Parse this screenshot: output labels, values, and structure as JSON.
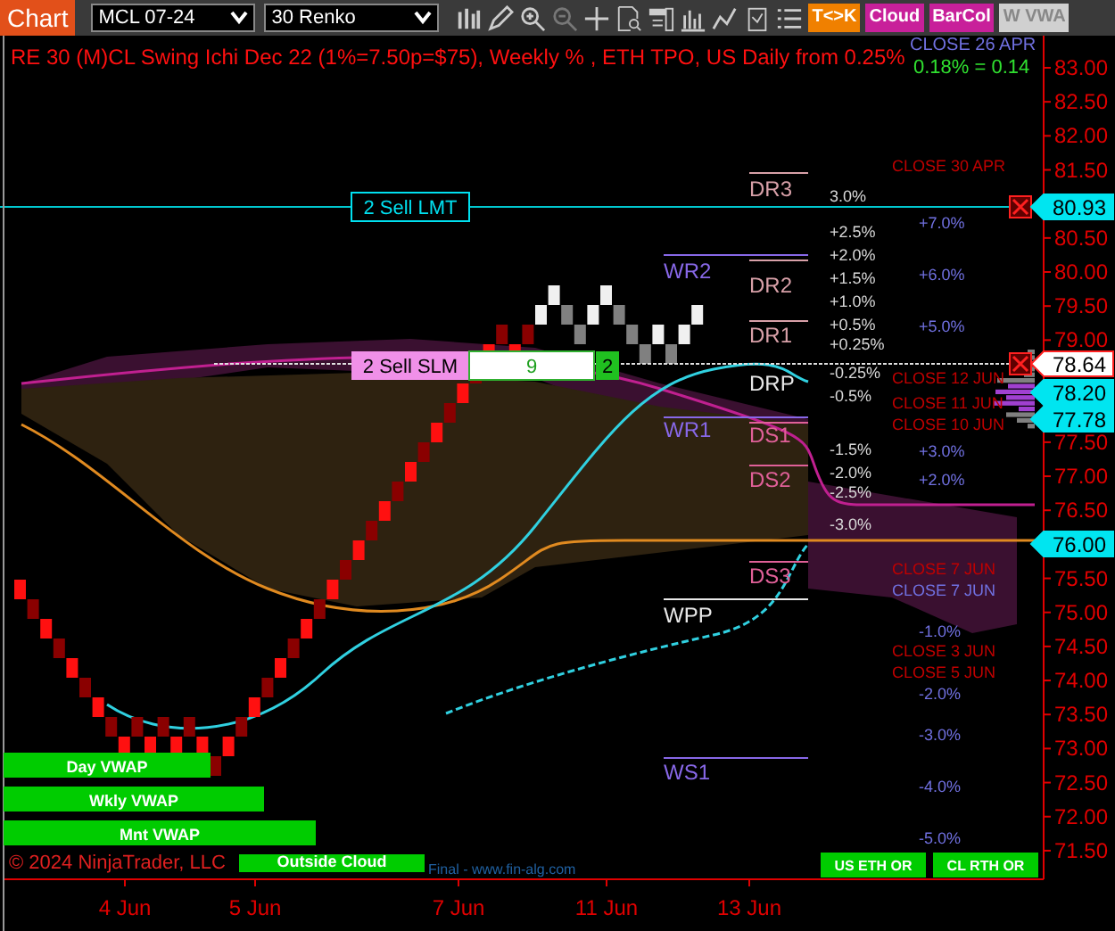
{
  "toolbar": {
    "tab": "Chart",
    "instrument": "MCL 07-24",
    "interval": "30 Renko",
    "buttons": [
      {
        "label": "T<>K",
        "color": "#f08000"
      },
      {
        "label": "Cloud",
        "color": "#c8209a"
      },
      {
        "label": "BarCol",
        "color": "#c8209a"
      },
      {
        "label": "W VWA",
        "color": "#d0d0d0"
      }
    ]
  },
  "chart": {
    "title": "RE 30 (M)CL Swing Ichi Dec 22  (1%=7.50p=$75), Weekly % , ETH TPO, US Daily from 0.25%",
    "corner_close": "CLOSE 26 APR",
    "corner_change": "0.18% = 0.14",
    "price_axis": [
      "83.00",
      "82.50",
      "82.00",
      "81.50",
      "80.50",
      "80.00",
      "79.50",
      "79.00",
      "77.50",
      "77.00",
      "76.50",
      "75.50",
      "75.00",
      "74.50",
      "74.00",
      "73.50",
      "73.00",
      "72.50",
      "72.00",
      "71.50"
    ],
    "price_markers": [
      {
        "label": "80.93",
        "kind": "level"
      },
      {
        "label": "78.64",
        "kind": "last"
      },
      {
        "label": "78.20",
        "kind": "level"
      },
      {
        "label": "77.78",
        "kind": "level"
      },
      {
        "label": "76.00",
        "kind": "level"
      }
    ],
    "orders": [
      {
        "label": "2 Sell LMT",
        "kind": "limit"
      },
      {
        "label": "2 Sell SLM",
        "kind": "stop",
        "ticks": "9",
        "quantity": "2"
      }
    ],
    "pivots": [
      {
        "label": "DR3",
        "kind": "daily"
      },
      {
        "label": "WR2",
        "kind": "weekly"
      },
      {
        "label": "DR2",
        "kind": "daily"
      },
      {
        "label": "DR1",
        "kind": "daily"
      },
      {
        "label": "DRP",
        "kind": "pivot"
      },
      {
        "label": "WR1",
        "kind": "weekly"
      },
      {
        "label": "DS1",
        "kind": "support"
      },
      {
        "label": "DS2",
        "kind": "support"
      },
      {
        "label": "DS3",
        "kind": "support"
      },
      {
        "label": "WPP",
        "kind": "pivot"
      },
      {
        "label": "WS1",
        "kind": "weekly"
      }
    ],
    "daily_percent": [
      "3.0%",
      "+2.5%",
      "+2.0%",
      "+1.5%",
      "+1.0%",
      "+0.5%",
      "+0.25%",
      "-0.25%",
      "-0.5%",
      "-1.5%",
      "-2.0%",
      "-2.5%",
      "-3.0%"
    ],
    "weekly_percent": [
      "+7.0%",
      "+6.0%",
      "+5.0%",
      "+3.0%",
      "+2.0%",
      "-1.0%",
      "-2.0%",
      "-3.0%",
      "-4.0%",
      "-5.0%"
    ],
    "closes": [
      {
        "label": "CLOSE 30 APR",
        "color": "#c00000"
      },
      {
        "label": "CLOSE 12 JUN",
        "color": "#c00000"
      },
      {
        "label": "CLOSE 11 JUN",
        "color": "#c00000"
      },
      {
        "label": "CLOSE 10 JUN",
        "color": "#c00000"
      },
      {
        "label": "CLOSE 7 JUN",
        "color": "#c00000"
      },
      {
        "label": "CLOSE 7 JUN",
        "color": "#7070e0"
      },
      {
        "label": "CLOSE 3 JUN",
        "color": "#c00000"
      },
      {
        "label": "CLOSE 5 JUN",
        "color": "#c00000"
      }
    ],
    "indicators": [
      "Day VWAP",
      "Wkly VWAP",
      "Mnt VWAP",
      "Outside Cloud"
    ],
    "session_markers": [
      "US ETH OR",
      "CL RTH OR"
    ],
    "copyright": "© 2024 NinjaTrader, LLC",
    "credit": "Final - www.fin-alg.com",
    "date_axis": [
      "4 Jun",
      "5 Jun",
      "7 Jun",
      "11 Jun",
      "13 Jun"
    ]
  }
}
